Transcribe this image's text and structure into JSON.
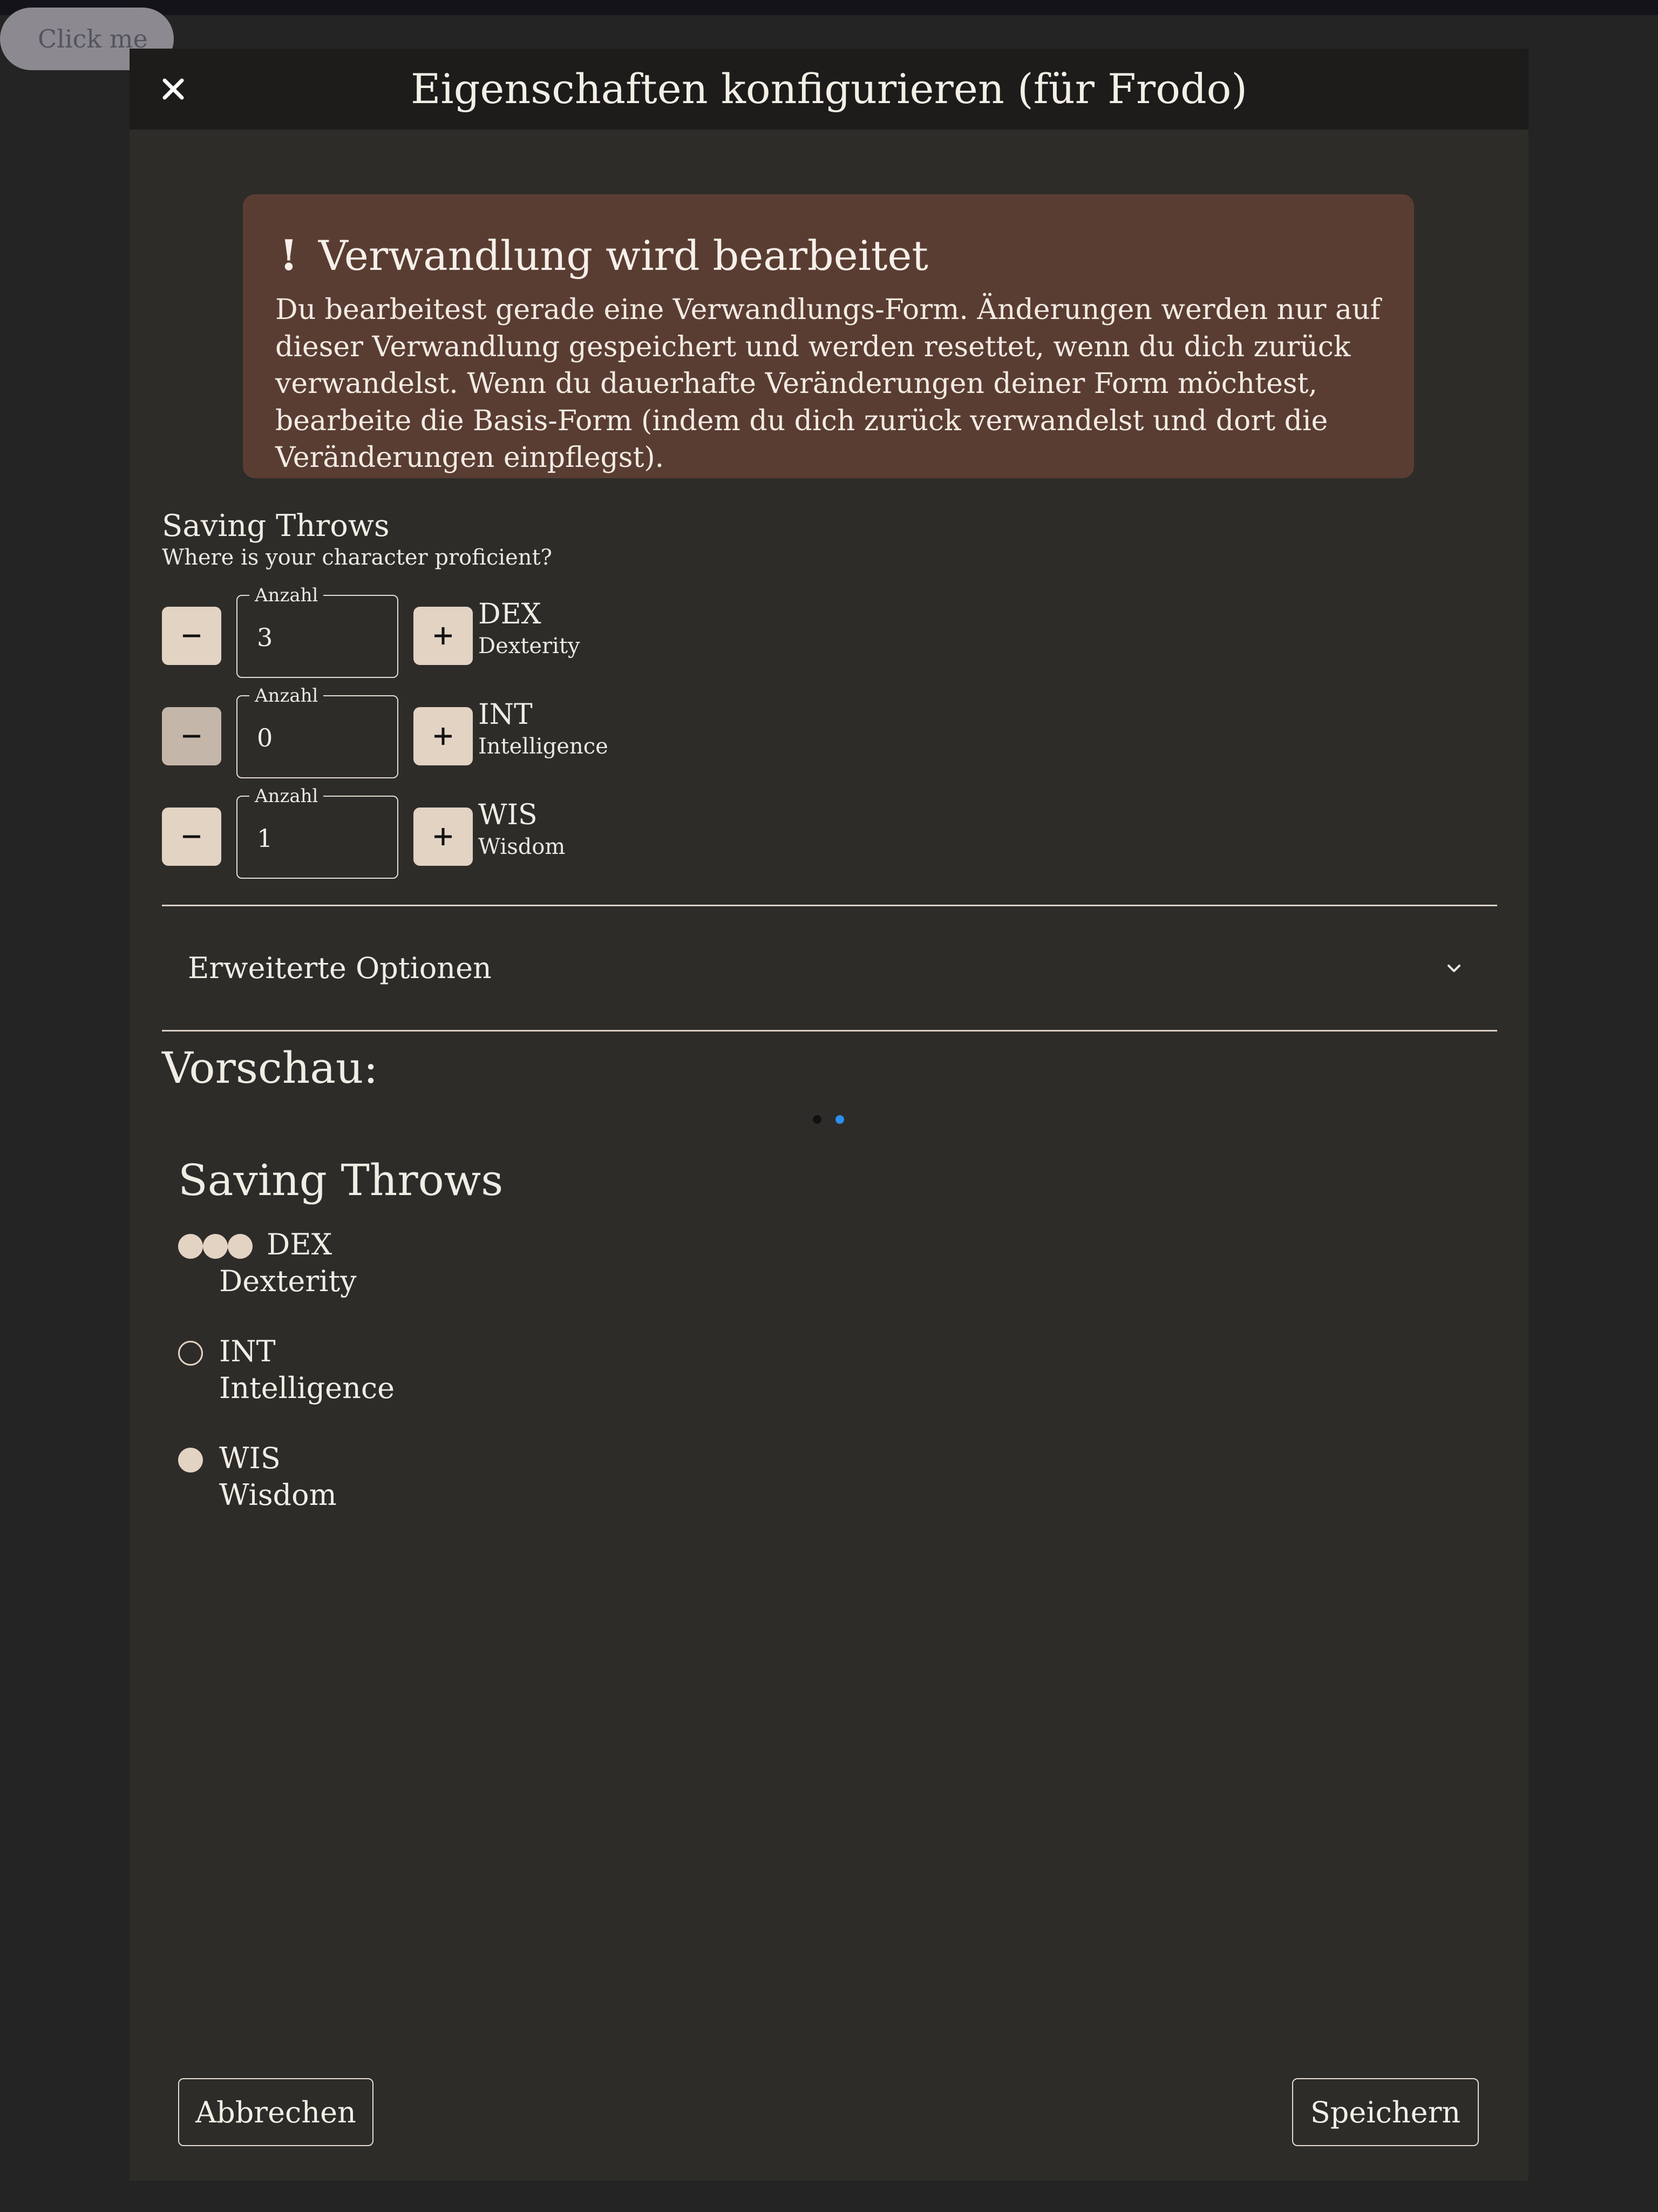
{
  "background_button": {
    "label": "Click me"
  },
  "dialog": {
    "title": "Eigenschaften konfigurieren (für Frodo)",
    "close_icon": "close-icon"
  },
  "alert": {
    "icon": "!",
    "title": "Verwandlung wird bearbeitet",
    "body": "Du bearbeitest gerade eine Verwandlungs-Form. Änderungen werden nur auf dieser Verwandlung gespeichert und werden resettet, wenn du dich zurück verwandelst. Wenn du dauerhafte Veränderungen deiner Form möchtest, bearbeite die Basis-Form (indem du dich zurück verwandelst und dort die Veränderungen einpflegst).",
    "color": "#5a3d32"
  },
  "saving_throws": {
    "title": "Saving Throws",
    "subtitle": "Where is your character proficient?",
    "field_label": "Anzahl",
    "rows": [
      {
        "abbr": "DEX",
        "name": "Dexterity",
        "value": "3",
        "minus_disabled": false
      },
      {
        "abbr": "INT",
        "name": "Intelligence",
        "value": "0",
        "minus_disabled": true
      },
      {
        "abbr": "WIS",
        "name": "Wisdom",
        "value": "1",
        "minus_disabled": false
      }
    ]
  },
  "advanced": {
    "label": "Erweiterte Optionen",
    "icon": "chevron-down-icon"
  },
  "preview": {
    "label": "Vorschau:",
    "carousel_active_index": 1,
    "heading": "Saving Throws",
    "items": [
      {
        "abbr": "DEX",
        "name": "Dexterity",
        "proficiency": 3
      },
      {
        "abbr": "INT",
        "name": "Intelligence",
        "proficiency": 0
      },
      {
        "abbr": "WIS",
        "name": "Wisdom",
        "proficiency": 1
      }
    ]
  },
  "footer": {
    "cancel_label": "Abbrechen",
    "save_label": "Speichern"
  },
  "colors": {
    "accent": "#e3d3c3",
    "dialog_bg": "#2d2c29",
    "header_bg": "#1d1c1b",
    "dot_active": "#2a8ff0"
  }
}
